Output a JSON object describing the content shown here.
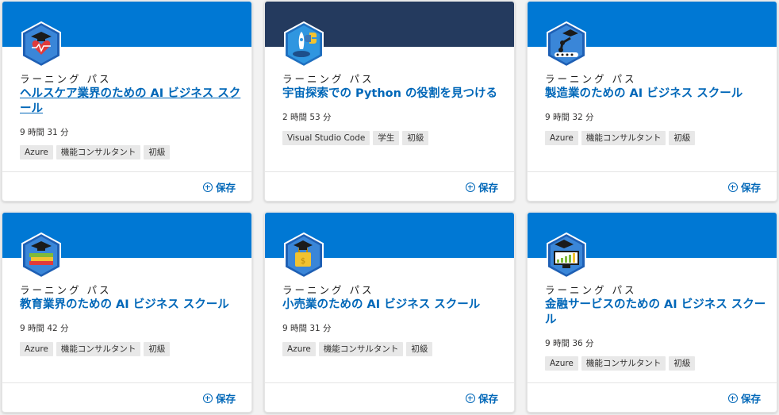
{
  "colors": {
    "band_blue": "#0078d4",
    "band_navy": "#243a5e",
    "link_blue": "#0067b8"
  },
  "cards": [
    {
      "kicker": "ラーニング パス",
      "title": "ヘルスケア業界のための AI ビジネス スクール",
      "duration": "9 時間 31 分",
      "tags": [
        "Azure",
        "機能コンサルタント",
        "初級"
      ],
      "save": "保存",
      "band": "blue",
      "badge_icon": "healthcare-heart-icon"
    },
    {
      "kicker": "ラーニング パス",
      "title": "宇宙探索での Python の役割を見つける",
      "duration": "2 時間 53 分",
      "tags": [
        "Visual Studio Code",
        "学生",
        "初級"
      ],
      "save": "保存",
      "band": "navy",
      "badge_icon": "rocket-python-icon"
    },
    {
      "kicker": "ラーニング パス",
      "title": "製造業のための AI ビジネス スクール",
      "duration": "9 時間 32 分",
      "tags": [
        "Azure",
        "機能コンサルタント",
        "初級"
      ],
      "save": "保存",
      "band": "blue",
      "badge_icon": "robot-arm-icon"
    },
    {
      "kicker": "ラーニング パス",
      "title": "教育業界のための AI ビジネス スクール",
      "duration": "9 時間 42 分",
      "tags": [
        "Azure",
        "機能コンサルタント",
        "初級"
      ],
      "save": "保存",
      "band": "blue",
      "badge_icon": "books-icon"
    },
    {
      "kicker": "ラーニング パス",
      "title": "小売業のための AI ビジネス スクール",
      "duration": "9 時間 31 分",
      "tags": [
        "Azure",
        "機能コンサルタント",
        "初級"
      ],
      "save": "保存",
      "band": "blue",
      "badge_icon": "shopping-bag-icon"
    },
    {
      "kicker": "ラーニング パス",
      "title": "金融サービスのための AI ビジネス スクール",
      "duration": "9 時間 36 分",
      "tags": [
        "Azure",
        "機能コンサルタント",
        "初級"
      ],
      "save": "保存",
      "band": "blue",
      "badge_icon": "finance-chart-icon"
    }
  ]
}
